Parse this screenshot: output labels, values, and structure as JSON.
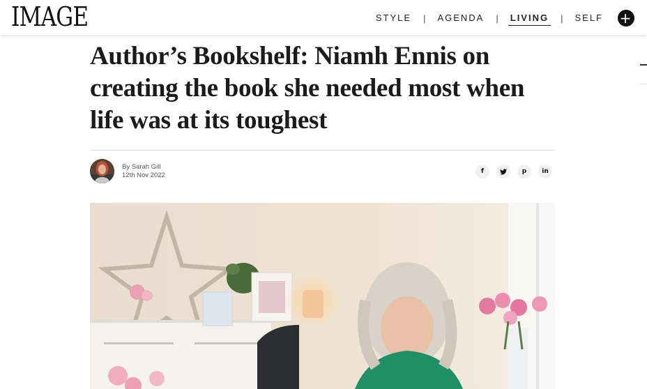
{
  "header": {
    "logo": "IMAGE",
    "nav": [
      {
        "label": "STYLE",
        "active": false
      },
      {
        "label": "AGENDA",
        "active": false
      },
      {
        "label": "LIVING",
        "active": true
      },
      {
        "label": "SELF",
        "active": false
      }
    ],
    "separator": "|",
    "plus_icon": "plus-circle-icon"
  },
  "article": {
    "headline": "Author’s Bookshelf: Niamh Ennis on creating the book she needed most when life was at its toughest",
    "byline_author": "By Sarah Gill",
    "byline_date": "12th Nov 2022"
  },
  "share": {
    "facebook": "f",
    "twitter": "twitter-bird-icon",
    "pinterest": "p",
    "linkedin": "in"
  },
  "colors": {
    "text": "#1b1b1b",
    "nav_text": "#222222",
    "divider": "#d8d8d8",
    "share_bg": "#f1f1f1"
  }
}
